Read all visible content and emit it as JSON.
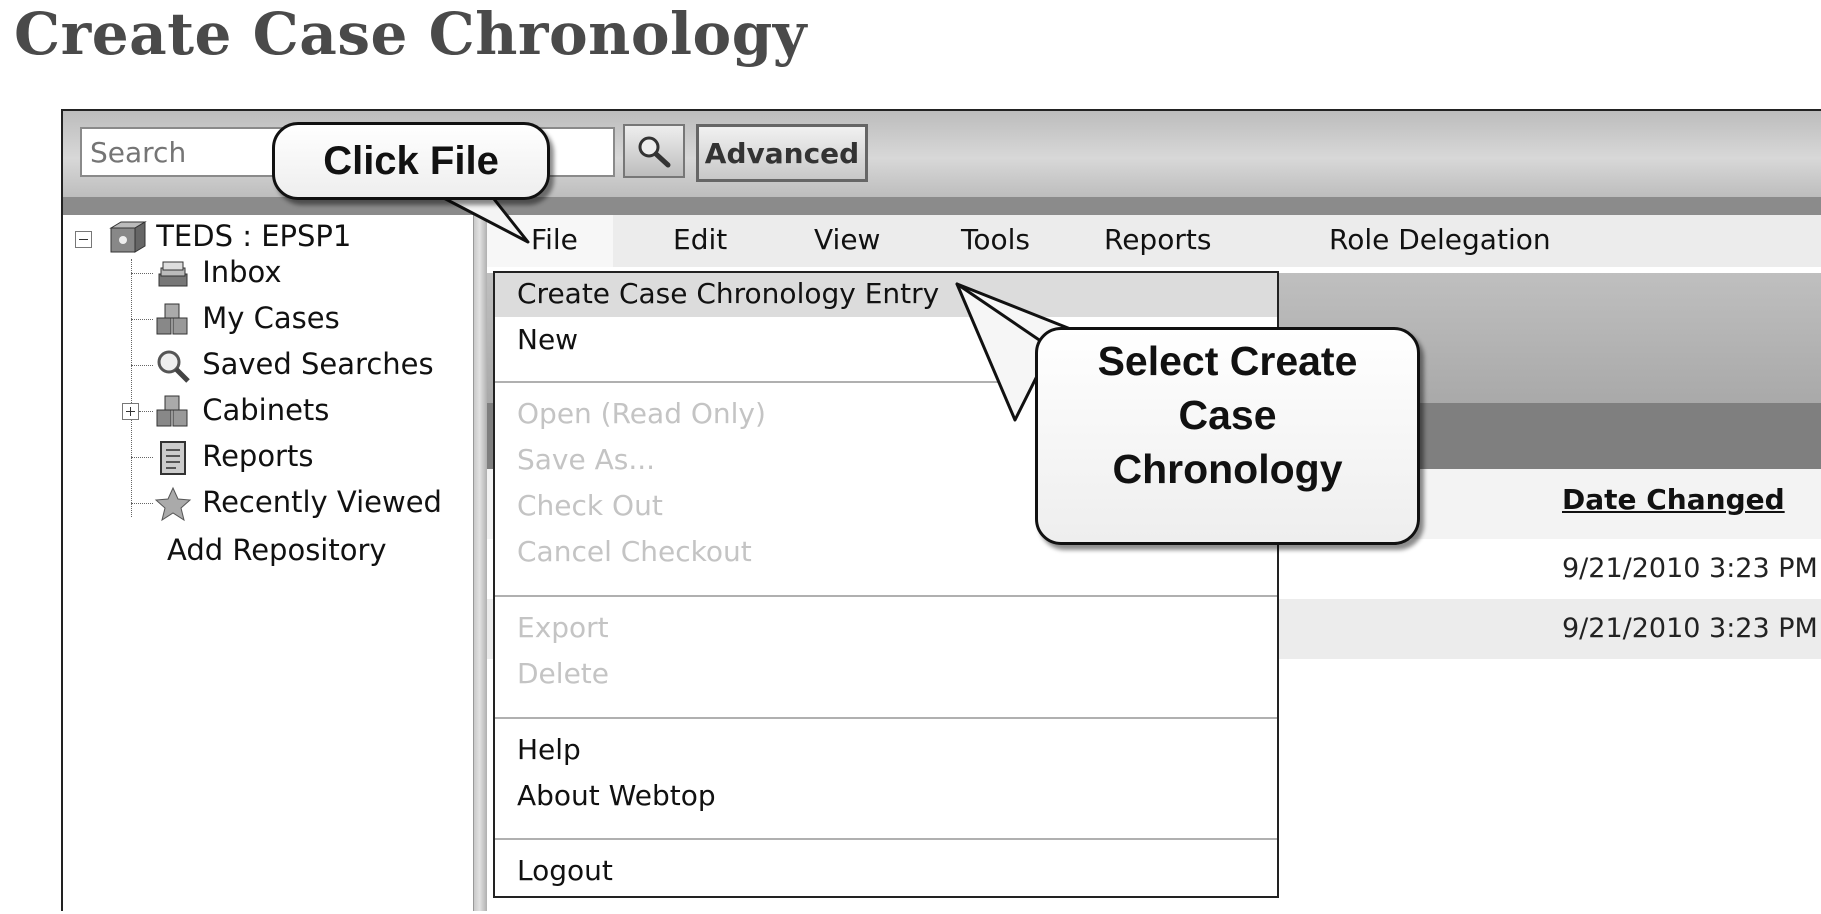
{
  "document": {
    "title": "Create Case Chronology"
  },
  "topbar": {
    "search_placeholder": "Search",
    "advanced_label": "Advanced"
  },
  "tree": {
    "root": "TEDS : EPSP1",
    "items": [
      {
        "label": "Inbox",
        "icon": "inbox-icon"
      },
      {
        "label": "My Cases",
        "icon": "cases-icon"
      },
      {
        "label": "Saved Searches",
        "icon": "magnifier-icon"
      },
      {
        "label": "Cabinets",
        "icon": "cabinet-icon"
      },
      {
        "label": "Reports",
        "icon": "report-icon"
      },
      {
        "label": "Recently Viewed",
        "icon": "star-icon"
      }
    ],
    "add_repository": "Add Repository"
  },
  "menubar": [
    "File",
    "Edit",
    "View",
    "Tools",
    "Reports",
    "Role Delegation"
  ],
  "file_menu": {
    "group1": [
      "Create Case Chronology Entry",
      "New"
    ],
    "group2": [
      "Open (Read Only)",
      "Save As...",
      "Check Out",
      "Cancel Checkout"
    ],
    "group3": [
      "Export",
      "Delete"
    ],
    "group4": [
      "Help",
      "About Webtop"
    ],
    "group5": [
      "Logout"
    ]
  },
  "table": {
    "column_date": "Date Changed",
    "rows": [
      {
        "date": "9/21/2010 3:23 PM"
      },
      {
        "date": "9/21/2010 3:23 PM"
      }
    ]
  },
  "callouts": {
    "click_file": "Click File",
    "select_create": [
      "Select Create",
      "Case",
      "Chronology"
    ]
  }
}
